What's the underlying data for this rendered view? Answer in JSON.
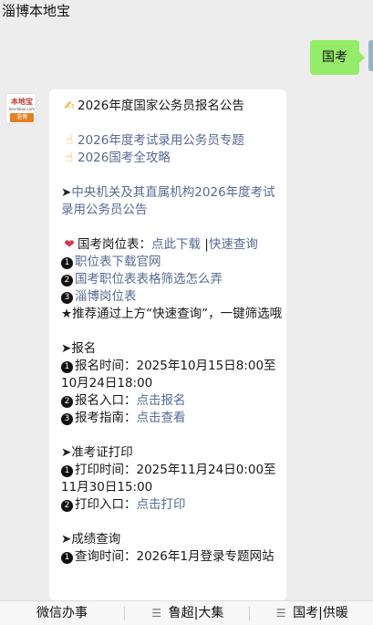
{
  "window": {
    "title": "淄博本地宝"
  },
  "user_message": {
    "text": "国考"
  },
  "article": {
    "lines": [
      {
        "icon": "✍",
        "text": "2026年度国家公务员报名公告",
        "type": "plain"
      },
      {
        "blank": true
      },
      {
        "icon": "☝",
        "text": "2026年度考试录用公务员专题",
        "type": "link"
      },
      {
        "icon": "☝",
        "text": "2026国考全攻略",
        "type": "link"
      },
      {
        "blank": true
      },
      {
        "prefix": "➤",
        "text": "中央机关及其直属机构2026年度考试录用公务员公告",
        "type": "link"
      },
      {
        "blank": true
      },
      {
        "icon": "❤",
        "text_plain": "国考岗位表：",
        "text_link": "点此下载",
        "sep": " |",
        "text_link2": "快速查询"
      },
      {
        "num": "1",
        "text": "职位表下载官网",
        "type": "link"
      },
      {
        "num": "2",
        "text": "国考职位表表格筛选怎么弄",
        "type": "link"
      },
      {
        "num": "3",
        "text": "淄博岗位表",
        "type": "link"
      },
      {
        "prefix": "★",
        "text": "推荐通过上方“快速查询”，一键筛选哦",
        "type": "plain"
      },
      {
        "blank": true
      },
      {
        "prefix": "➤",
        "text": "报名",
        "type": "plain"
      },
      {
        "num": "1",
        "text": "报名时间：2025年10月15日8:00至10月24日18:00",
        "type": "plain"
      },
      {
        "num": "2",
        "text_plain": "报名入口：",
        "text_link": "点击报名"
      },
      {
        "num": "3",
        "text_plain": "报考指南：",
        "text_link": "点击查看"
      },
      {
        "blank": true
      },
      {
        "prefix": "➤",
        "text": "准考证打印",
        "type": "plain"
      },
      {
        "num": "1",
        "text": "打印时间：2025年11月24日0:00至11月30日15:00",
        "type": "plain"
      },
      {
        "num": "2",
        "text_plain": "打印入口：",
        "text_link": "点击打印"
      },
      {
        "blank": true
      },
      {
        "prefix": "➤",
        "text": "成绩查询",
        "type": "plain"
      },
      {
        "num": "1",
        "text": "查询时间：2026年1月登录专题网站",
        "type": "plain"
      }
    ]
  },
  "bottom_menu": [
    {
      "label": "微信办事",
      "icon": ""
    },
    {
      "label": "鲁超|大集",
      "icon": "menu-icon"
    },
    {
      "label": "国考|供暖",
      "icon": "menu-icon"
    }
  ],
  "colors": {
    "background": "#ededed",
    "user_bubble": "#95ec69",
    "link": "#576b95",
    "card": "#ffffff"
  }
}
